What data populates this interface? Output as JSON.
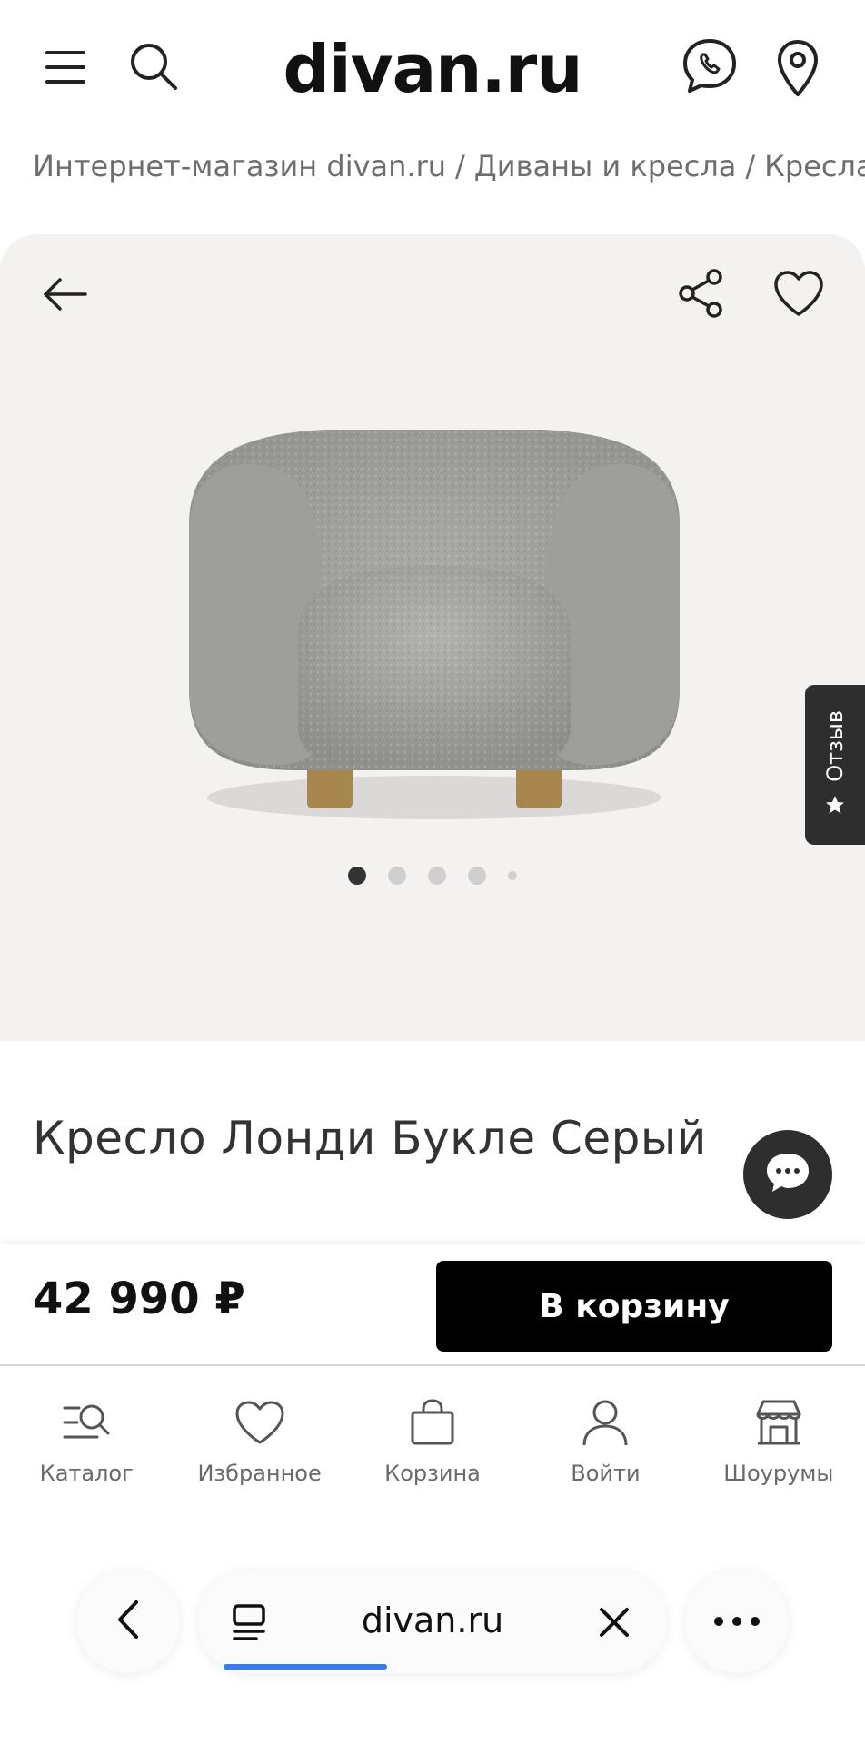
{
  "header": {
    "logo": "divan.ru",
    "icons": [
      "menu-icon",
      "search-icon",
      "phone-icon",
      "location-pin-icon"
    ]
  },
  "breadcrumb": {
    "items": [
      "Интернет-магазин divan.ru",
      "Диваны и кресла",
      "Кресла"
    ],
    "separator": "/"
  },
  "gallery": {
    "image_alt": "Кресло Лонди Букле Серый",
    "slide_count": 5,
    "active_slide": 1
  },
  "review_tab": {
    "label": "Отзыв"
  },
  "product": {
    "title": "Кресло Лонди Букле Серый",
    "price": "42 990 ₽",
    "add_to_cart": "В корзину"
  },
  "tabbar": {
    "items": [
      {
        "label": "Каталог",
        "icon": "catalog-search-icon"
      },
      {
        "label": "Избранное",
        "icon": "heart-icon"
      },
      {
        "label": "Корзина",
        "icon": "shopping-bag-icon"
      },
      {
        "label": "Войти",
        "icon": "user-icon"
      },
      {
        "label": "Шоурумы",
        "icon": "store-icon"
      }
    ]
  },
  "browser": {
    "url": "divan.ru",
    "load_progress": 0.28
  },
  "colors": {
    "accent": "#000000",
    "gallery_bg": "#f3f2f0",
    "progress": "#3b7ae8"
  }
}
